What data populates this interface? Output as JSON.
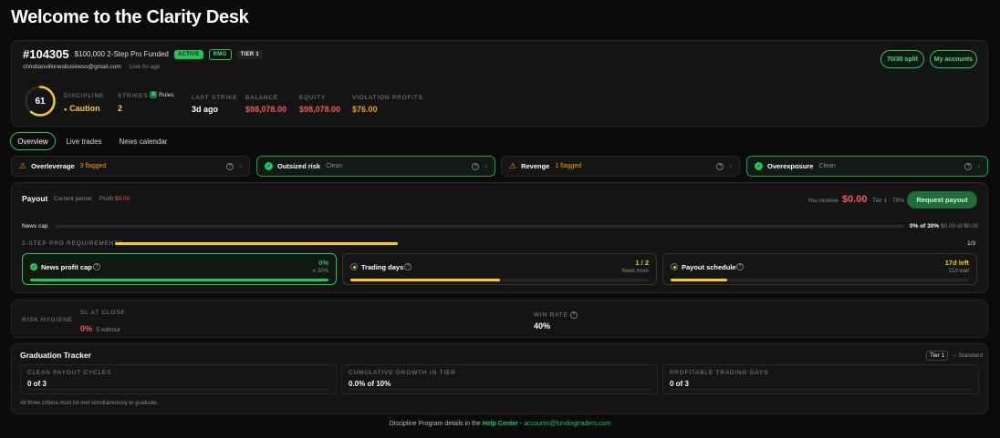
{
  "page_title": "Welcome to the Clarity Desk",
  "account": {
    "id": "#104305",
    "plan": "$100,000 2-Step Pro Funded",
    "badges": [
      "ACTIVE",
      "RMG",
      "TIER 1"
    ],
    "email": "christianvillonesbusiness@gmail.com",
    "live": "Live 0s ago",
    "split_button": "70/30 split",
    "accounts_button": "My accounts"
  },
  "stats": {
    "score": "61",
    "score_fraction": 0.61,
    "discipline_label": "DISCIPLINE",
    "discipline_value": "Caution",
    "strikes_label": "STRIKES",
    "rules_label": "Rules",
    "strikes_value": "2",
    "last_strike_label": "LAST STRIKE",
    "last_strike_value": "3d ago",
    "balance_label": "BALANCE",
    "balance_value": "$98,078.00",
    "equity_label": "EQUITY",
    "equity_value": "$98,078.00",
    "violation_label": "VIOLATION PROFITS",
    "violation_value": "$76.00"
  },
  "tabs": [
    "Overview",
    "Live trades",
    "News calendar"
  ],
  "rules": [
    {
      "name": "Overleverage",
      "status": "3 flagged",
      "ok": false
    },
    {
      "name": "Outsized risk",
      "status": "Clean",
      "ok": true
    },
    {
      "name": "Revenge",
      "status": "1 flagged",
      "ok": false
    },
    {
      "name": "Overexposure",
      "status": "Clean",
      "ok": true
    }
  ],
  "payout": {
    "title": "Payout",
    "period": "Current period",
    "profit_label": "Profit",
    "profit_value": "$0.00",
    "receive_label": "You receive",
    "receive_value": "$0.00",
    "tier": "Tier 1 · 70%",
    "request_button": "Request payout",
    "news_cap_label": "News cap",
    "news_cap_pct": "0% of 30%",
    "news_cap_amount": "$0.00 of $0.00",
    "news_cap_fraction": 0,
    "requirements_label": "2-STEP PRO REQUIREMENTS",
    "requirements_count": "1/3",
    "requirements_fraction": 0.333
  },
  "requirements": [
    {
      "name": "News profit cap",
      "right1": "0%",
      "right2": "≤ 30%",
      "ok": true,
      "fraction": 1.0
    },
    {
      "name": "Trading days",
      "right1": "1 / 2",
      "right2": "Need more",
      "ok": false,
      "fraction": 0.5
    },
    {
      "name": "Payout schedule",
      "right1": "17d left",
      "right2": "21d wait",
      "ok": false,
      "fraction": 0.19
    }
  ],
  "hygiene": {
    "label": "RISK HYGIENE",
    "sl_label": "SL AT CLOSE",
    "sl_value": "0%",
    "sl_sub": "5 without",
    "win_label": "WIN RATE",
    "win_value": "40%"
  },
  "graduation": {
    "title": "Graduation Tracker",
    "tier_from": "Tier 1",
    "tier_to": "→ Standard",
    "boxes": [
      {
        "label": "CLEAN PAYOUT CYCLES",
        "value": "0 of 3"
      },
      {
        "label": "CUMULATIVE GROWTH IN TIER",
        "value": "0.0% of 10%"
      },
      {
        "label": "PROFITABLE TRADING DAYS",
        "value": "0 of 3"
      }
    ],
    "note": "All three criteria must be met simultaneously to graduate."
  },
  "footer": {
    "prefix": "Discipline Program details in the",
    "link": "Help Center",
    "sep": " - ",
    "email": "accounts@fundingtraders.com"
  },
  "colors": {
    "accent": "#22c55e",
    "danger": "#f05a5a",
    "warn": "#facc15"
  }
}
